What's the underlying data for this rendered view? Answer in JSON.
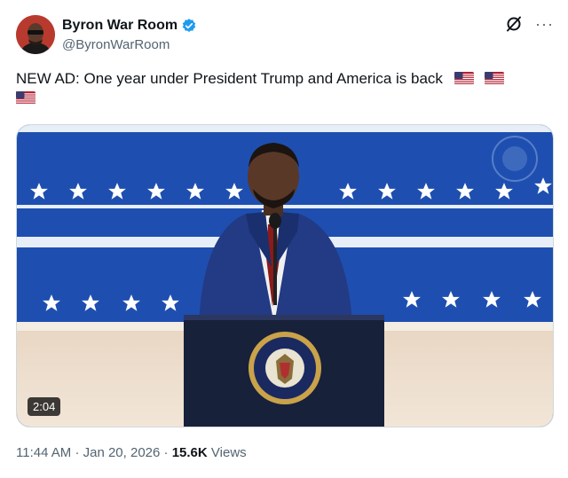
{
  "author": {
    "display_name": "Byron War Room",
    "handle": "@ByronWarRoom",
    "verified": true,
    "avatar_icon": "profile-avatar"
  },
  "actions": {
    "grok_icon": "grok-icon",
    "more_label": "···"
  },
  "tweet": {
    "text": "NEW AD: One year under President Trump and America is back",
    "emoji": [
      "us-flag-emoji",
      "us-flag-emoji",
      "us-flag-emoji"
    ]
  },
  "media": {
    "type": "video",
    "duration": "2:04",
    "seal_text": "SEAL OF THE PRESIDENT OF THE UNITED STATES"
  },
  "meta": {
    "time": "11:44 AM",
    "separator1": "·",
    "date": "Jan 20, 2026",
    "separator2": "·",
    "views_count": "15.6K",
    "views_label": "Views"
  },
  "colors": {
    "verified_blue": "#1d9bf0",
    "text_primary": "#0f1419",
    "text_secondary": "#536471",
    "backdrop_blue": "#1e4fb0"
  }
}
